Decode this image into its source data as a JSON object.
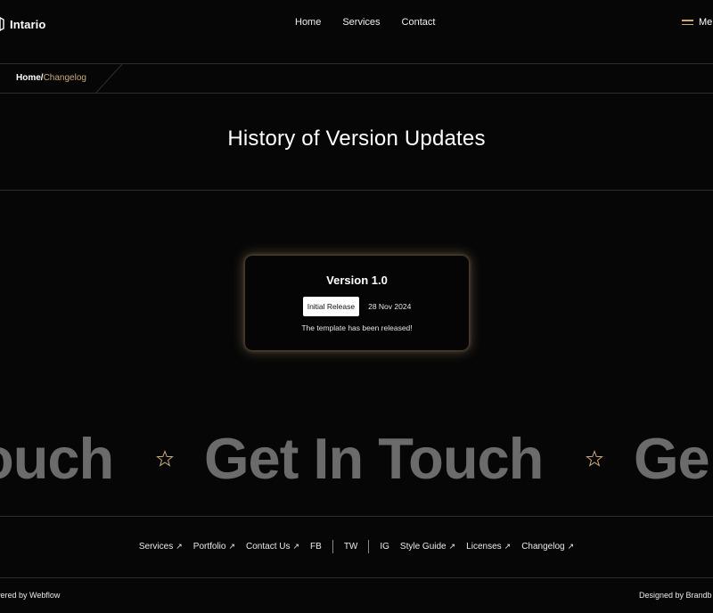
{
  "header": {
    "brand": "Intario",
    "nav": [
      {
        "label": "Home"
      },
      {
        "label": "Services"
      },
      {
        "label": "Contact"
      }
    ],
    "menu_label": "Menu",
    "menu_label_visible": "Mer"
  },
  "breadcrumb": {
    "home": "Home",
    "separator": "/",
    "current": "Changelog"
  },
  "page": {
    "title": "History of Version Updates"
  },
  "changelog": {
    "version": "Version 1.0",
    "tag": "Initial Release",
    "date": "28 Nov 2024",
    "description": "The template has been released!"
  },
  "marquee": {
    "fragments": [
      "ouch",
      "Get In Touch",
      "Ge"
    ]
  },
  "footer": {
    "links": [
      {
        "label": "Services",
        "arrow": "↗"
      },
      {
        "label": "Portfolio",
        "arrow": "↗"
      },
      {
        "label": "Contact Us",
        "arrow": "↗"
      },
      {
        "label": "FB"
      },
      {
        "label": "TW"
      },
      {
        "label": "IG"
      },
      {
        "label": "Style Guide",
        "arrow": "↗"
      },
      {
        "label": "Licenses",
        "arrow": "↗"
      },
      {
        "label": "Changelog",
        "arrow": "↗"
      }
    ],
    "powered_visible": "wered by Webflow",
    "designed_visible": "Designed by Brandb"
  },
  "colors": {
    "background": "#060606",
    "accent": "#c9a97e",
    "marquee_text": "#6b6b6b",
    "divider": "#2e2e2e"
  },
  "icons": {
    "logo": "logo-mark-icon",
    "menu": "hamburger-icon",
    "star": "star-outline-icon",
    "external": "arrow-up-right-icon"
  }
}
